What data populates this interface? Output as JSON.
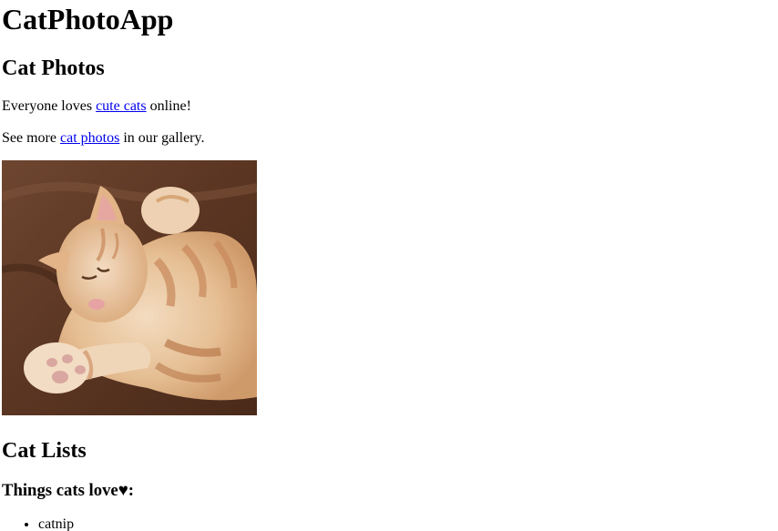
{
  "header": {
    "title": "CatPhotoApp"
  },
  "photos_section": {
    "heading": "Cat Photos",
    "paragraph1": {
      "before": "Everyone loves ",
      "link": "cute cats",
      "after": " online!"
    },
    "paragraph2": {
      "before": "See more ",
      "link": "cat photos",
      "after": " in our gallery."
    },
    "image_alt": "A cute orange cat lying on its back."
  },
  "lists_section": {
    "heading": "Cat Lists",
    "subheading": "Things cats love♥:",
    "love_items": [
      "catnip"
    ]
  },
  "colors": {
    "link": "#0000ee",
    "text": "#000000",
    "background": "#ffffff"
  }
}
